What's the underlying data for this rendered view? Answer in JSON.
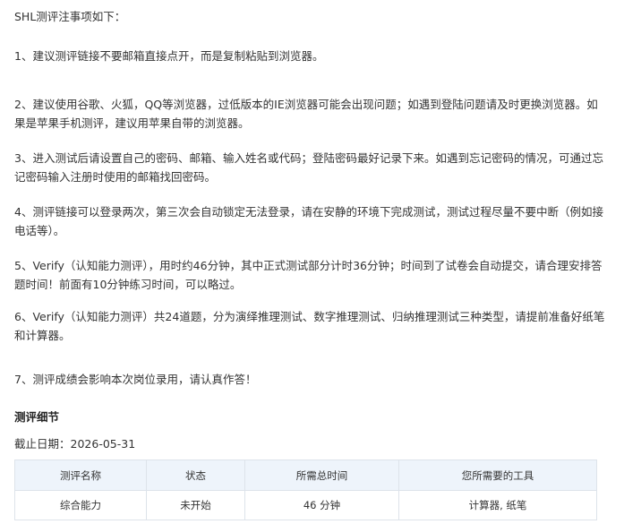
{
  "intro": "SHL测评注事项如下：",
  "notes": [
    "1、建议测评链接不要邮箱直接点开，而是复制粘贴到浏览器。",
    "2、建议使用谷歌、火狐，QQ等浏览器，过低版本的IE浏览器可能会出现问题；如遇到登陆问题请及时更换浏览器。如果是苹果手机测评，建议用苹果自带的浏览器。",
    "3、进入测试后请设置自己的密码、邮箱、输入姓名或代码；登陆密码最好记录下来。如遇到忘记密码的情况，可通过忘记密码输入注册时使用的邮箱找回密码。",
    "4、测评链接可以登录两次，第三次会自动锁定无法登录，请在安静的环境下完成测试，测试过程尽量不要中断（例如接电话等）。",
    "5、Verify（认知能力测评），用时约46分钟，其中正式测试部分计时36分钟；时间到了试卷会自动提交，请合理安排答题时间！前面有10分钟练习时间，可以略过。",
    "6、Verify（认知能力测评）共24道题，分为演绎推理测试、数字推理测试、归纳推理测试三种类型，请提前准备好纸笔和计算器。",
    "7、测评成绩会影响本次岗位录用，请认真作答！"
  ],
  "details": {
    "title": "测评细节",
    "deadline_label": "截止日期：",
    "deadline_value": "2026-05-31"
  },
  "table": {
    "headers": [
      "测评名称",
      "状态",
      "所需总时间",
      "您所需要的工具"
    ],
    "rows": [
      [
        "综合能力",
        "未开始",
        "46 分钟",
        "计算器, 纸笔"
      ]
    ]
  }
}
